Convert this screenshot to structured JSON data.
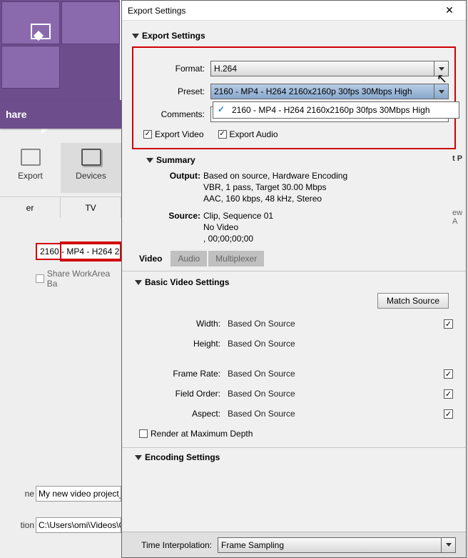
{
  "bg": {
    "share_header": "hare",
    "targets": {
      "export": "Export",
      "devices": "Devices"
    },
    "tabs2": {
      "er": "er",
      "tv": "TV"
    },
    "preset_btn": "2160 - MP4 - H264 21",
    "share_workarea": "Share WorkArea Ba",
    "name_label": "ne",
    "location_label": "tion",
    "name_value": "My new video project_",
    "location_value": "C:\\Users\\omi\\Videos\\O"
  },
  "dialog": {
    "title": "Export Settings",
    "export_settings_header": "Export Settings",
    "format_label": "Format:",
    "format_value": "H.264",
    "preset_label": "Preset:",
    "preset_value": "2160 - MP4 - H264 2160x2160p 30fps 30Mbps High",
    "preset_option": "2160 - MP4 - H264 2160x2160p 30fps 30Mbps High",
    "comments_label": "Comments:",
    "export_video": "Export Video",
    "export_audio": "Export Audio",
    "summary_header": "Summary",
    "output_label": "Output:",
    "output_l1": "Based on source, Hardware Encoding",
    "output_l2": "VBR, 1 pass, Target 30.00 Mbps",
    "output_l3": "AAC, 160 kbps, 48 kHz, Stereo",
    "source_label": "Source:",
    "source_l1": "Clip, Sequence 01",
    "source_l2": "No Video",
    "source_l3": ", 00;00;00;00",
    "tab_video": "Video",
    "tab_audio": "Audio",
    "tab_mux": "Multiplexer",
    "basic_header": "Basic Video Settings",
    "match_source": "Match Source",
    "width_label": "Width:",
    "height_label": "Height:",
    "framerate_label": "Frame Rate:",
    "fieldorder_label": "Field Order:",
    "aspect_label": "Aspect:",
    "based_on_source": "Based On Source",
    "render_max_depth": "Render at Maximum Depth",
    "encoding_header": "Encoding Settings",
    "time_interp_label": "Time Interpolation:",
    "time_interp_value": "Frame Sampling"
  },
  "frags": {
    "viewall": "ew A",
    "tp": "t P"
  }
}
